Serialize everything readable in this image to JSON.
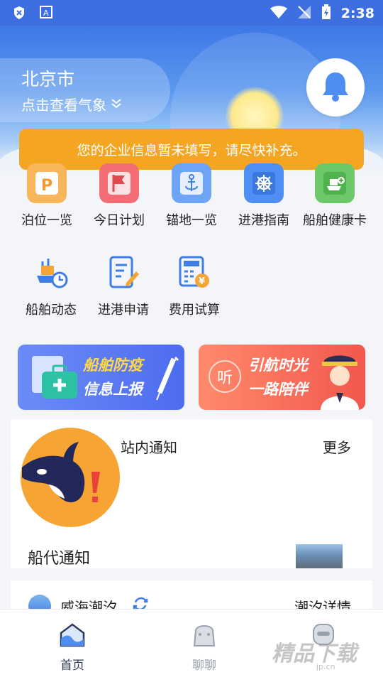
{
  "status_bar": {
    "time": "2:38"
  },
  "header": {
    "city": "北京市",
    "weather_link": "点击查看气象",
    "notice": "您的企业信息暂未填写，请尽快补充。"
  },
  "grid": {
    "items": [
      {
        "label": "泊位一览",
        "icon": "parking-icon"
      },
      {
        "label": "今日计划",
        "icon": "flag-icon"
      },
      {
        "label": "锚地一览",
        "icon": "anchor-icon"
      },
      {
        "label": "进港指南",
        "icon": "helm-icon"
      },
      {
        "label": "船舶健康卡",
        "icon": "ship-health-icon"
      },
      {
        "label": "船舶动态",
        "icon": "ship-clock-icon"
      },
      {
        "label": "进港申请",
        "icon": "edit-doc-icon"
      },
      {
        "label": "费用试算",
        "icon": "calculator-icon"
      }
    ]
  },
  "promos": {
    "left": {
      "line1": "船舶防疫",
      "line2": "信息上报"
    },
    "right": {
      "badge": "听",
      "line1": "引航时光",
      "line2": "一路陪伴"
    }
  },
  "notices": {
    "title": "站内通知",
    "more": "更多",
    "agent_title": "船代通知"
  },
  "tide": {
    "name": "威海潮汐",
    "detail": "潮汐详情"
  },
  "tabbar": {
    "home": "首页",
    "chat": "聊聊"
  },
  "watermark": {
    "text": "精品下载",
    "url": "jp.cn"
  },
  "colors": {
    "primary": "#3e6fe0",
    "warning": "#f4a623",
    "promo_blue": "#5b7cf2",
    "promo_red": "#f2574e",
    "tab_active": "#2f3b59"
  }
}
